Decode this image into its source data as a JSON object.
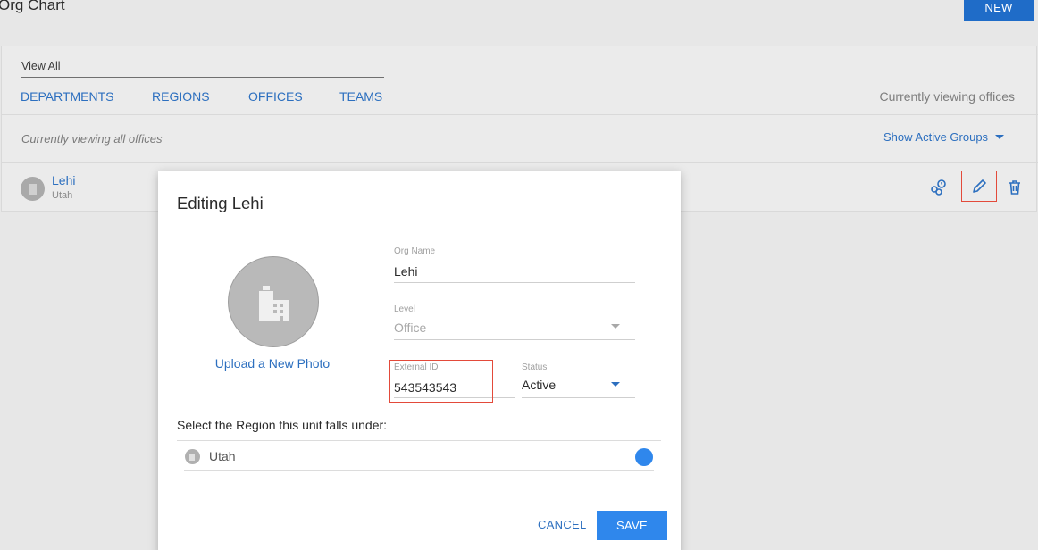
{
  "page": {
    "title": "Org Chart",
    "new_label": "NEW"
  },
  "card": {
    "view_all": "View All",
    "tabs": [
      {
        "label": "DEPARTMENTS"
      },
      {
        "label": "REGIONS"
      },
      {
        "label": "OFFICES"
      },
      {
        "label": "TEAMS"
      }
    ],
    "currently_viewing": "Currently viewing offices",
    "viewing_all": "Currently viewing all offices",
    "show_active": "Show Active Groups",
    "row": {
      "name": "Lehi",
      "sub": "Utah"
    }
  },
  "modal": {
    "title": "Editing Lehi",
    "upload_label": "Upload a New Photo",
    "org_name": {
      "label": "Org Name",
      "value": "Lehi"
    },
    "level": {
      "label": "Level",
      "value": "Office"
    },
    "external_id": {
      "label": "External ID",
      "value": "543543543"
    },
    "status": {
      "label": "Status",
      "value": "Active"
    },
    "region_prompt": "Select the Region this unit falls under:",
    "region_option": "Utah",
    "cancel_label": "CANCEL",
    "save_label": "SAVE"
  },
  "colors": {
    "accent": "#2c6fbf",
    "primary_button": "#2f87ec",
    "highlight": "#e34a3a"
  }
}
